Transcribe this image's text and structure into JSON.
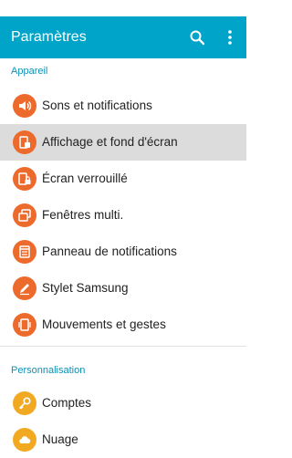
{
  "header": {
    "title": "Paramètres",
    "color": "#00a4c9"
  },
  "sections": [
    {
      "title": "Appareil",
      "items": [
        {
          "label": "Sons et notifications",
          "icon": "speaker-icon"
        },
        {
          "label": "Affichage et fond d'écran",
          "icon": "display-icon",
          "selected": true
        },
        {
          "label": "Écran verrouillé",
          "icon": "lock-screen-icon"
        },
        {
          "label": "Fenêtres multi.",
          "icon": "multi-window-icon"
        },
        {
          "label": "Panneau de notifications",
          "icon": "notification-panel-icon"
        },
        {
          "label": "Stylet Samsung",
          "icon": "pen-icon"
        },
        {
          "label": "Mouvements et gestes",
          "icon": "gesture-icon"
        }
      ]
    },
    {
      "title": "Personnalisation",
      "items": [
        {
          "label": "Comptes",
          "icon": "key-icon"
        },
        {
          "label": "Nuage",
          "icon": "cloud-icon"
        }
      ]
    }
  ],
  "colors": {
    "accent": "#00a4c9",
    "section_header": "#0f8fb3",
    "icon_device": "#ed6a2d",
    "icon_personal": "#f2a922"
  }
}
